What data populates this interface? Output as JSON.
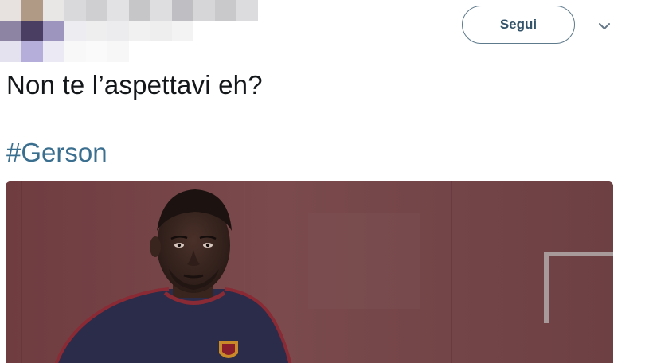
{
  "header": {
    "follow_label": "Segui",
    "menu_icon": "chevron-down-icon",
    "avatar_blurred": true
  },
  "tweet": {
    "text": "Non te l’aspettavi eh?",
    "hashtag": "#Gerson"
  },
  "media": {
    "type": "photo",
    "description_icon": "photo-player-in-jersey"
  },
  "colors": {
    "follow_border": "#5d7a8c",
    "follow_text": "#33536a",
    "hashtag": "#3b6f8f",
    "tweet_text": "#14171a",
    "photo_wall": "#6a3b3e"
  }
}
